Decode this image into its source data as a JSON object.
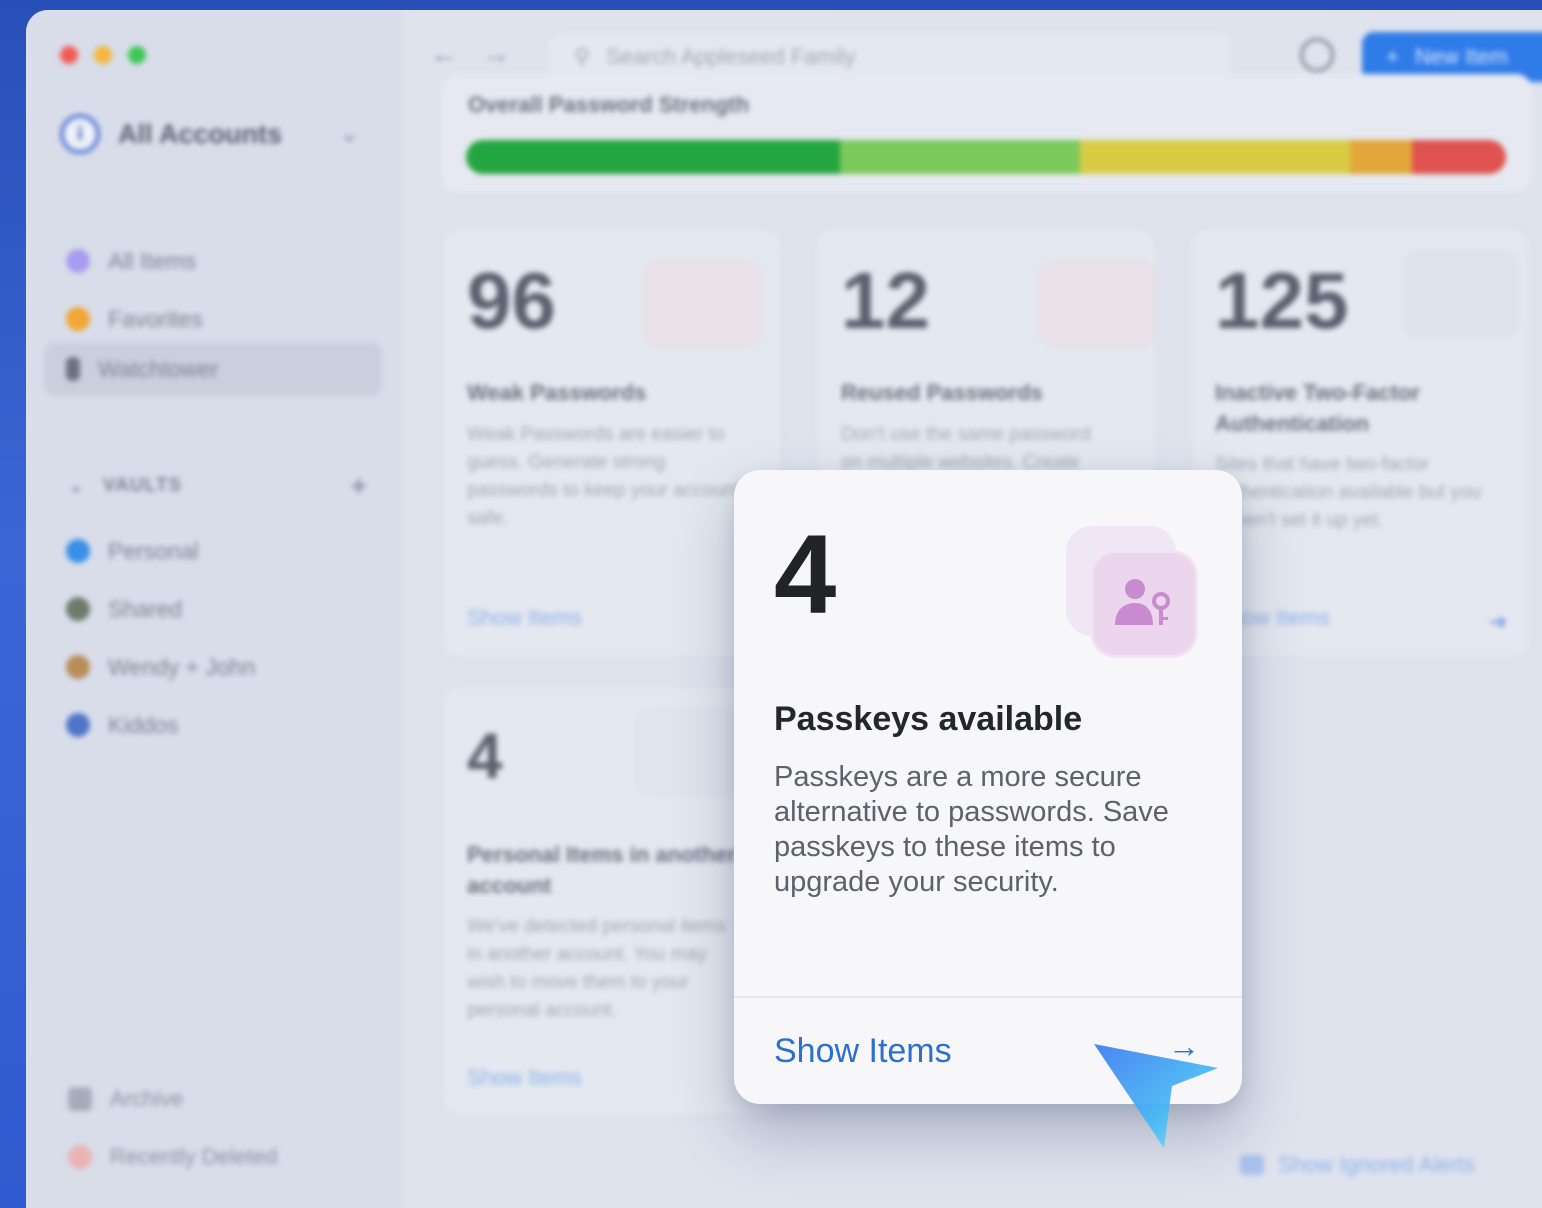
{
  "window": {
    "title": "All Accounts"
  },
  "sidebar": {
    "account_label": "All Accounts",
    "items": [
      {
        "label": "All Items",
        "icon": "sparkle-icon",
        "color": "#8f7ee6"
      },
      {
        "label": "Favorites",
        "icon": "star-icon",
        "color": "#f1a636"
      },
      {
        "label": "Watchtower",
        "icon": "tower-icon",
        "color": "#6b7284"
      }
    ],
    "vaults_header": "VAULTS",
    "vaults": [
      {
        "label": "Personal",
        "color": "#3a8fe8"
      },
      {
        "label": "Shared",
        "color": "#6e7b6a"
      },
      {
        "label": "Wendy + John",
        "color": "#b98d5a"
      },
      {
        "label": "Kiddos",
        "color": "#4f74c9"
      }
    ],
    "footer": [
      {
        "label": "Archive",
        "icon": "archive-icon"
      },
      {
        "label": "Recently Deleted",
        "icon": "trash-icon"
      }
    ]
  },
  "toolbar": {
    "search_placeholder": "Search Appleseed Family",
    "new_item_label": "New Item"
  },
  "strength": {
    "label": "Overall Password Strength",
    "segments": [
      {
        "color": "#23a640",
        "share": 0.36
      },
      {
        "color": "#7cc95c",
        "share": 0.23
      },
      {
        "color": "#d8cc45",
        "share": 0.26
      },
      {
        "color": "#e2a73a",
        "share": 0.06
      },
      {
        "color": "#e0524f",
        "share": 0.09
      }
    ]
  },
  "cards": [
    {
      "number": "96",
      "title": "Weak Passwords",
      "desc": "Weak Passwords are easier to guess. Generate strong passwords to keep your account safe.",
      "link": "Show Items"
    },
    {
      "number": "12",
      "title": "Reused Passwords",
      "desc": "Don't use the same password on multiple websites. Create",
      "link": ""
    },
    {
      "number": "125",
      "title": "Inactive Two-Factor Authentication",
      "desc": "Sites that have two-factor authentication available but you haven't set it up yet.",
      "link": "Show Items"
    },
    {
      "number": "4",
      "title": "Personal Items in another account",
      "desc": "We've detected personal items in another account. You may wish to move them to your personal account.",
      "link": "Show Items"
    }
  ],
  "ignored_link": "Show Ignored Alerts",
  "popup": {
    "number": "4",
    "title": "Passkeys available",
    "description": "Passkeys are a more secure alternative to passwords. Save passkeys to these items to upgrade your security.",
    "link": "Show Items",
    "accent": "#2d6fd0"
  }
}
